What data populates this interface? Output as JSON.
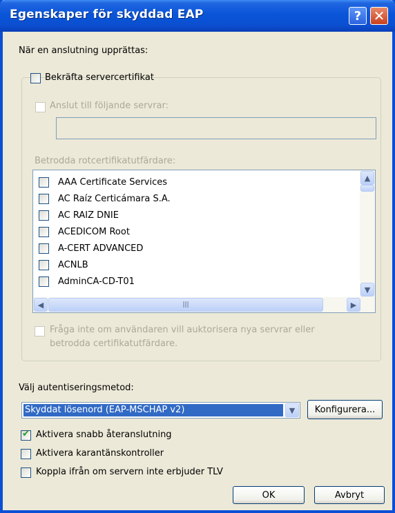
{
  "window": {
    "title": "Egenskaper för skyddad EAP",
    "help_label": "?",
    "close_label": "✕"
  },
  "connection": {
    "heading": "När en anslutning upprättas:",
    "verify_cert_label": "Bekräfta servercertifikat",
    "verify_cert_checked": false,
    "connect_servers_label": "Anslut till följande servrar:",
    "servers_value": "",
    "trusted_ca_label": "Betrodda rotcertifikatutfärdare:",
    "ca_list": [
      "AAA Certificate Services",
      "AC Raíz Certicámara S.A.",
      "AC RAIZ DNIE",
      "ACEDICOM Root",
      "A-CERT ADVANCED",
      "ACNLB",
      "AdminCA-CD-T01"
    ],
    "no_prompt_line1": "Fråga inte om användaren vill auktorisera nya servrar eller",
    "no_prompt_line2": "betrodda certifikatutfärdare."
  },
  "auth": {
    "method_label": "Välj autentiseringsmetod:",
    "method_value": "Skyddat lösenord (EAP-MSCHAP v2)",
    "configure_label": "Konfigurera..."
  },
  "options": {
    "fast_reconnect_label": "Aktivera snabb återanslutning",
    "fast_reconnect_checked": true,
    "quarantine_label": "Aktivera karantänskontroller",
    "quarantine_checked": false,
    "disconnect_tlv_label": "Koppla ifrån om servern inte erbjuder TLV",
    "disconnect_tlv_checked": false
  },
  "buttons": {
    "ok_label": "OK",
    "cancel_label": "Avbryt"
  },
  "icons": {
    "scroll_up": "▲",
    "scroll_down": "▼",
    "scroll_left": "◀",
    "scroll_right": "▶",
    "dropdown": "▼",
    "grip": "|||"
  },
  "colors": {
    "titlebar": "#0a55d9",
    "selection": "#316ac5",
    "window_bg": "#ece9d8"
  }
}
